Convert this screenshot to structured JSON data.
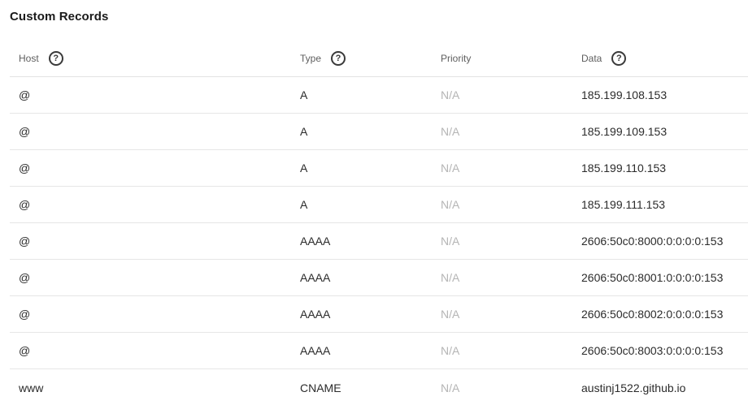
{
  "section": {
    "title": "Custom Records"
  },
  "table": {
    "headers": {
      "host": "Host",
      "type": "Type",
      "priority": "Priority",
      "data": "Data",
      "help_glyph": "?"
    },
    "rows": [
      {
        "host": "@",
        "type": "A",
        "priority": "N/A",
        "data": "185.199.108.153"
      },
      {
        "host": "@",
        "type": "A",
        "priority": "N/A",
        "data": "185.199.109.153"
      },
      {
        "host": "@",
        "type": "A",
        "priority": "N/A",
        "data": "185.199.110.153"
      },
      {
        "host": "@",
        "type": "A",
        "priority": "N/A",
        "data": "185.199.111.153"
      },
      {
        "host": "@",
        "type": "AAAA",
        "priority": "N/A",
        "data": "2606:50c0:8000:0:0:0:0:153"
      },
      {
        "host": "@",
        "type": "AAAA",
        "priority": "N/A",
        "data": "2606:50c0:8001:0:0:0:0:153"
      },
      {
        "host": "@",
        "type": "AAAA",
        "priority": "N/A",
        "data": "2606:50c0:8002:0:0:0:0:153"
      },
      {
        "host": "@",
        "type": "AAAA",
        "priority": "N/A",
        "data": "2606:50c0:8003:0:0:0:0:153"
      },
      {
        "host": "www",
        "type": "CNAME",
        "priority": "N/A",
        "data": "austinj1522.github.io"
      }
    ]
  }
}
